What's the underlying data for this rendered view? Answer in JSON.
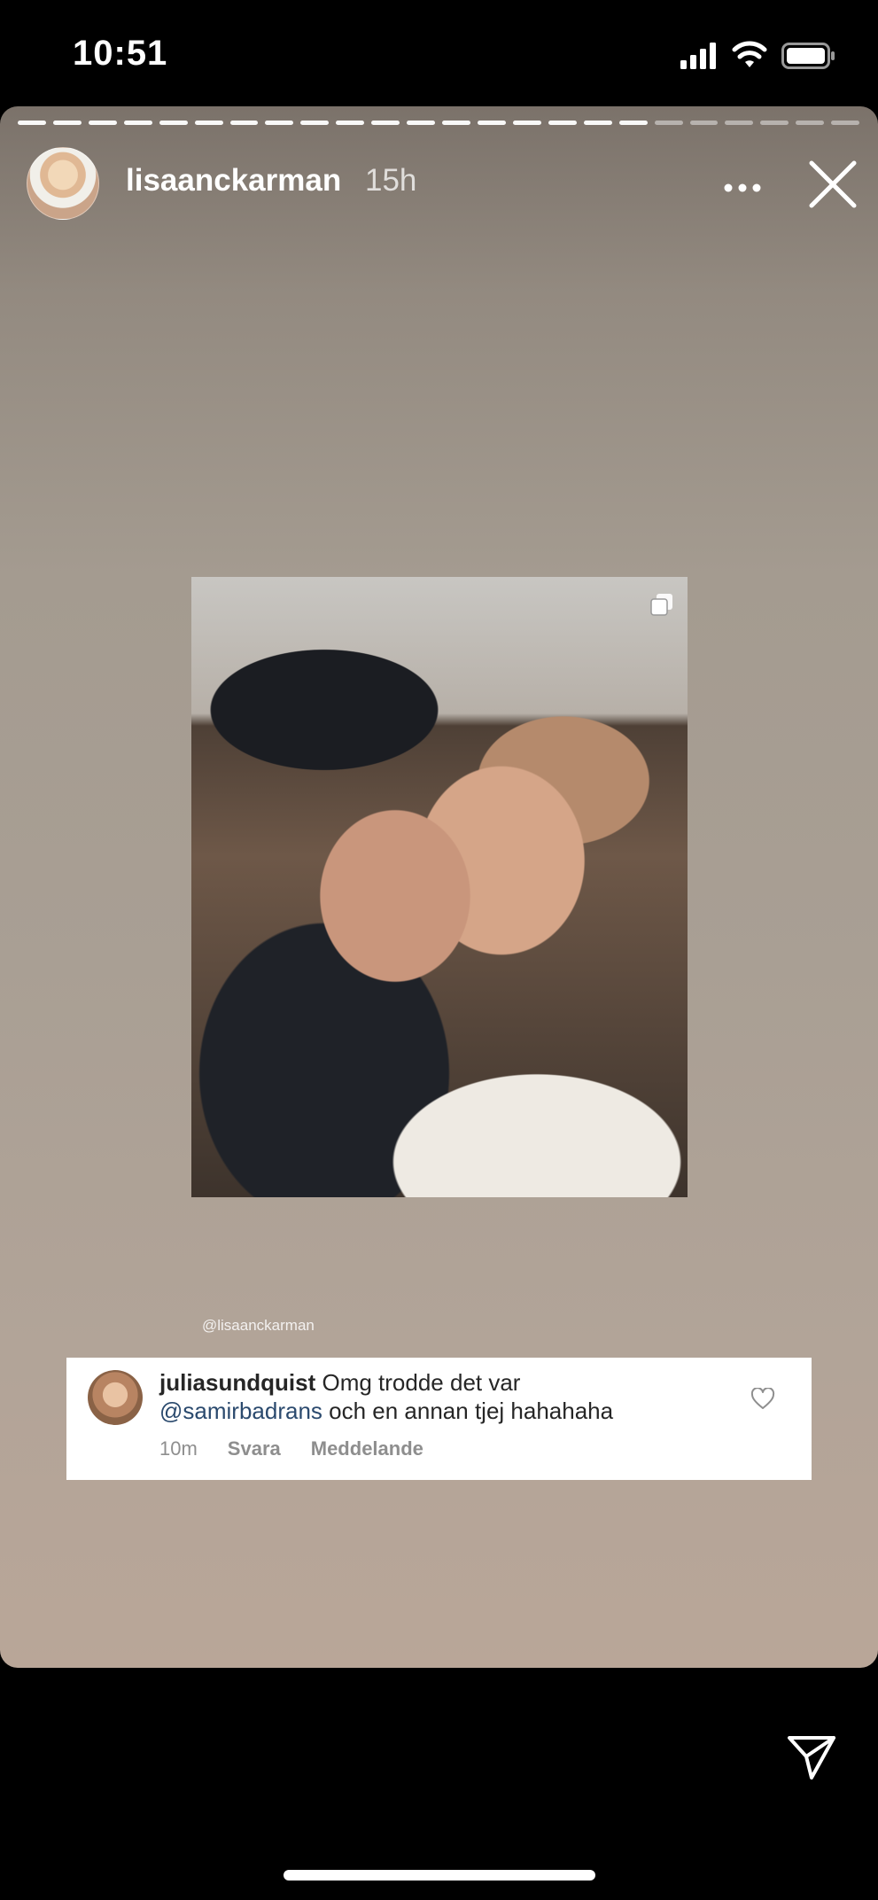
{
  "status_bar": {
    "time": "10:51"
  },
  "story": {
    "progress": {
      "segments_total": 24,
      "segments_viewed": 18
    },
    "username": "lisaanckarman",
    "age": "15h",
    "photo_credit": "@lisaanckarman",
    "comment": {
      "username": "juliasundquist",
      "text_start": "Omg trodde det var",
      "mention": "@samirbadrans",
      "text_end": "och en annan tjej hahahaha",
      "time": "10m",
      "reply_label": "Svara",
      "message_label": "Meddelande"
    }
  },
  "icons": {
    "more": "more-horizontal-icon",
    "close": "close-icon",
    "like": "heart-icon",
    "share": "send-icon",
    "multi_photo": "carousel-icon"
  }
}
